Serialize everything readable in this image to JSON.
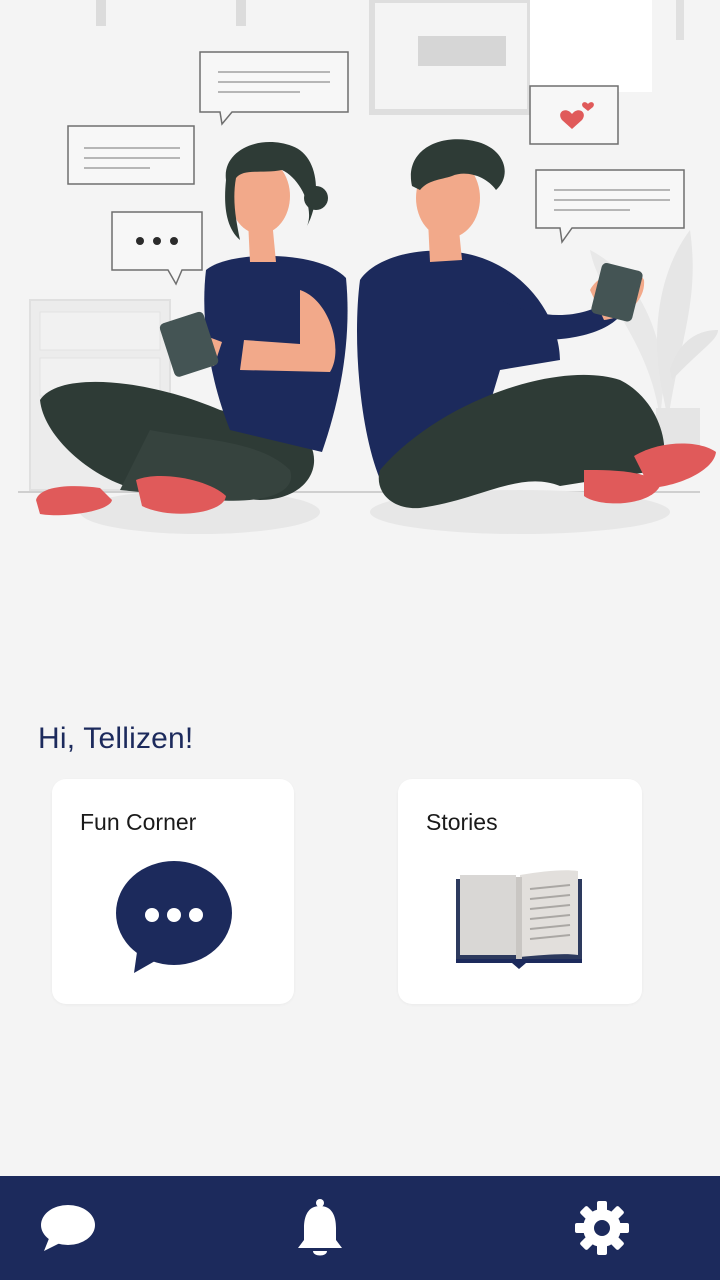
{
  "greeting": "Hi, Tellizen!",
  "cards": [
    {
      "title": "Fun Corner",
      "icon": "chat-bubble-icon"
    },
    {
      "title": "Stories",
      "icon": "open-book-icon"
    }
  ],
  "nav": {
    "items": [
      {
        "icon": "chat-icon"
      },
      {
        "icon": "bell-icon"
      },
      {
        "icon": "gear-icon"
      }
    ]
  },
  "colors": {
    "primary": "#1c2a5c",
    "background": "#f4f4f4",
    "card": "#ffffff",
    "accent_red": "#e05a5a"
  }
}
